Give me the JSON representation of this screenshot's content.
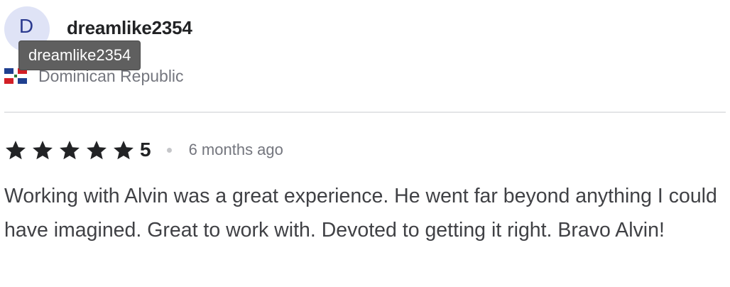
{
  "reviewer": {
    "avatar_initial": "D",
    "username": "dreamlike2354",
    "tooltip": "dreamlike2354",
    "country": "Dominican Republic",
    "flag_icon": "dominican-republic-flag-icon"
  },
  "review": {
    "stars": 5,
    "rating": "5",
    "time_ago": "6 months ago",
    "text": "Working with Alvin was a great experience. He went far beyond anything I could have imagined. Great to work with. Devoted to getting it right. Bravo Alvin!"
  },
  "colors": {
    "avatar_bg": "#dfe3f6",
    "avatar_text": "#2b3a8f",
    "star": "#222325",
    "muted_text": "#74767e",
    "tooltip_bg": "#5f5f5f"
  }
}
